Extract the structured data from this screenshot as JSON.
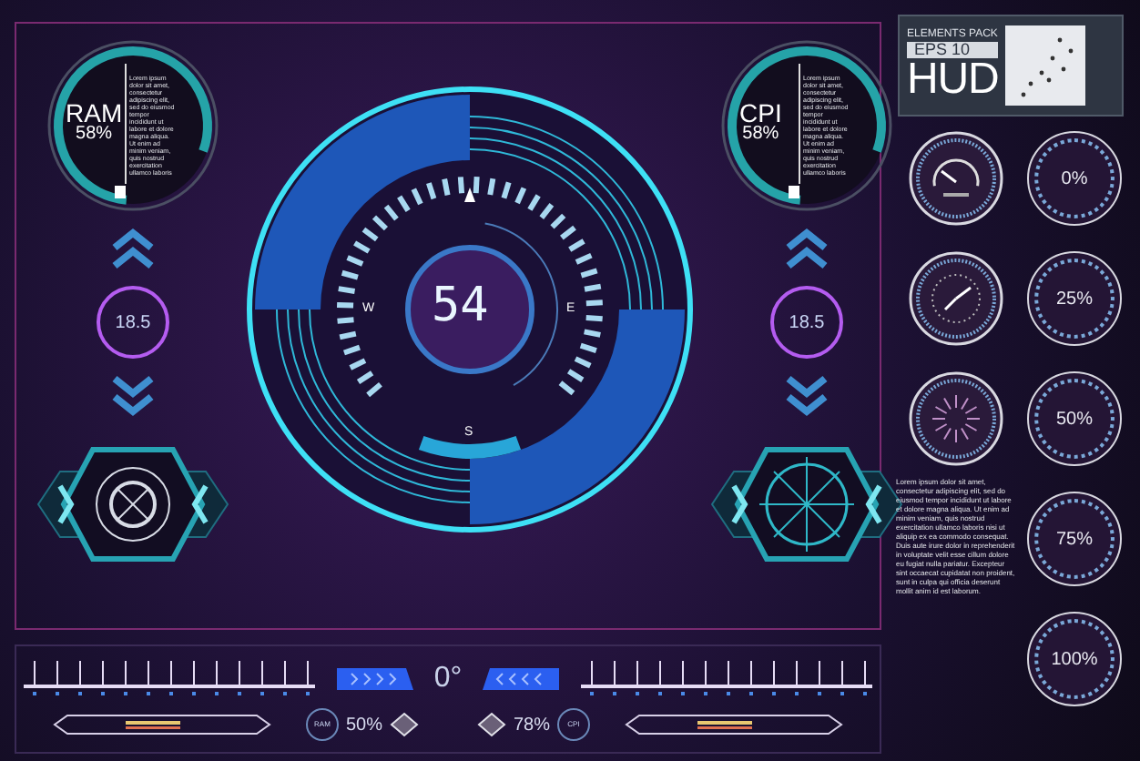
{
  "side_panels": [
    {
      "label": "RAM",
      "percent": "58%",
      "note": "Lorem ipsum dolor sit amet, consectetur adipiscing elit, sed do eiusmod tempor incididunt ut labore et dolore magna aliqua. Ut enim ad minim veniam, quis nostrud exercitation ullamco laboris",
      "readout": "18.5",
      "kind": "crosshair"
    },
    {
      "label": "CPI",
      "percent": "58%",
      "note": "Lorem ipsum dolor sit amet, consectetur adipiscing elit, sed do eiusmod tempor incididunt ut labore et dolore magna aliqua. Ut enim ad minim veniam, quis nostrud exercitation ullamco laboris",
      "readout": "18.5",
      "kind": "radar"
    }
  ],
  "dial": {
    "reading": "54",
    "west": "W",
    "east": "E",
    "south": "S"
  },
  "bottom_bar": {
    "heading": "0°",
    "left": {
      "badge": "RAM",
      "value": "50%"
    },
    "right": {
      "badge": "CPI",
      "value": "78%"
    }
  },
  "logo": {
    "subtitle": "ELEMENTS PACK",
    "edition": "EPS 10",
    "title": "HUD"
  },
  "gauges": [
    {
      "kind": "speedometer"
    },
    {
      "kind": "clock"
    },
    {
      "kind": "starburst"
    }
  ],
  "percent_rings": [
    "0%",
    "25%",
    "50%",
    "75%",
    "100%"
  ],
  "paragraph": "Lorem ipsum dolor sit amet, consectetur adipiscing elit, sed do eiusmod tempor incididunt ut labore et dolore magna aliqua. Ut enim ad minim veniam, quis nostrud exercitation ullamco laboris nisi ut aliquip ex ea commodo consequat. Duis aute irure dolor in reprehenderit in voluptate velit esse cillum dolore eu fugiat nulla pariatur. Excepteur sint occaecat cupidatat non proident, sunt in culpa qui officia deserunt mollit anim id est laborum."
}
